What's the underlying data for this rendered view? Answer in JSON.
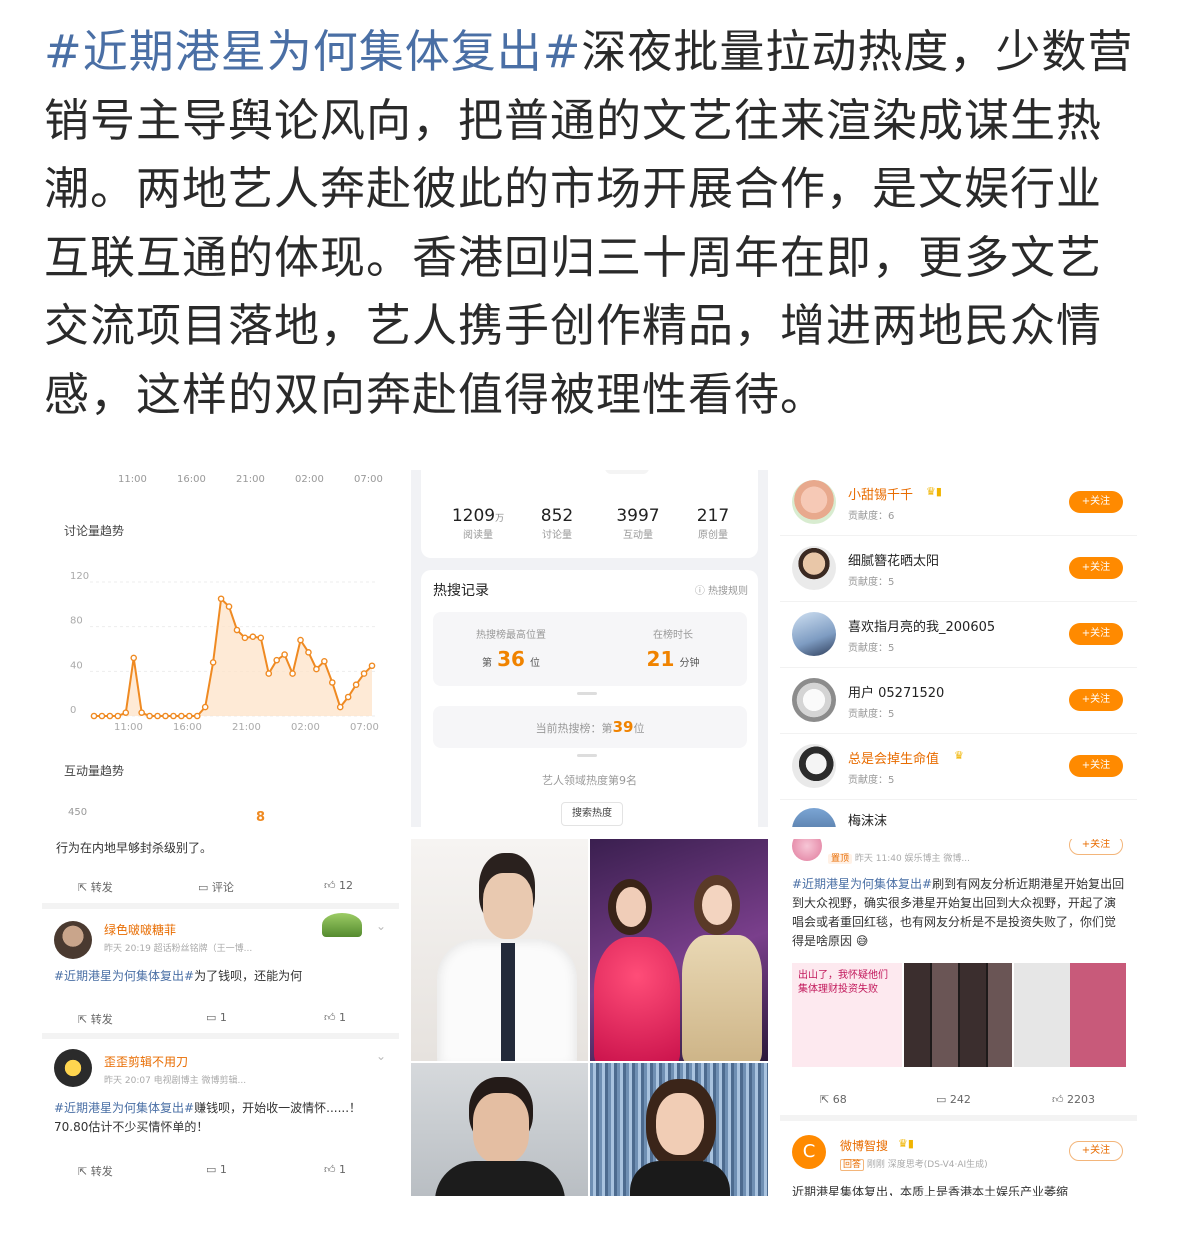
{
  "post": {
    "hashtag": "#近期港星为何集体复出#",
    "body": "深夜批量拉动热度，少数营销号主导舆论风向，把普通的文艺往来渲染成谋生热潮。两地艺人奔赴彼此的市场开展合作，是文娱行业互联互通的体现。香港回归三十周年在即，更多文艺交流项目落地，艺人携手创作精品，增进两地民众情感，这样的双向奔赴值得被理性看待。"
  },
  "trend_panel": {
    "top_ticks": [
      "11:00",
      "16:00",
      "21:00",
      "02:00",
      "07:00"
    ],
    "discussion_title": "讨论量趋势",
    "interaction_title": "互动量趋势",
    "interaction_tick": "450",
    "partial_marker": "8",
    "colors": {
      "line": "#ef8a22",
      "fill": "#fde3c8"
    }
  },
  "chart_data": {
    "type": "area",
    "title": "讨论量趋势",
    "x_ticks": [
      "11:00",
      "16:00",
      "21:00",
      "02:00",
      "07:00"
    ],
    "y_ticks": [
      0,
      40,
      80,
      120
    ],
    "ylim": [
      0,
      120
    ],
    "values": [
      0,
      0,
      0,
      0,
      3,
      52,
      3,
      0,
      0,
      0,
      0,
      0,
      0,
      0,
      8,
      48,
      105,
      98,
      77,
      70,
      71,
      70,
      38,
      50,
      55,
      38,
      68,
      57,
      42,
      49,
      30,
      8,
      17,
      28,
      38,
      45
    ],
    "grid": true
  },
  "stats_panel": {
    "overview": [
      {
        "value": "1209",
        "unit": "万",
        "label": "阅读量"
      },
      {
        "value": "852",
        "unit": "",
        "label": "讨论量"
      },
      {
        "value": "3997",
        "unit": "",
        "label": "互动量"
      },
      {
        "value": "217",
        "unit": "",
        "label": "原创量"
      }
    ],
    "hot_title": "热搜记录",
    "hot_rule": "热搜规则",
    "best_label": "热搜榜最高位置",
    "best_prefix": "第",
    "best_value": "36",
    "best_suffix": "位",
    "duration_label": "在榜时长",
    "duration_value": "21",
    "duration_unit": "分钟",
    "current_label": "当前热搜榜：第",
    "current_value": "39",
    "current_suffix": "位",
    "domain_rank": "艺人领域热度第9名",
    "search_heat": "搜索热度"
  },
  "contributors": {
    "follow_label": "+关注",
    "users": [
      {
        "name": "小甜锡千千",
        "contrib": "贡献度：6",
        "orange": true
      },
      {
        "name": "细腻簪花晒太阳",
        "contrib": "贡献度：5",
        "orange": false
      },
      {
        "name": "喜欢指月亮的我_200605",
        "contrib": "贡献度：5",
        "orange": false
      },
      {
        "name": "用户 05271520",
        "contrib": "贡献度：5",
        "orange": false
      },
      {
        "name": "总是会掉生命值",
        "contrib": "贡献度：5",
        "orange": true
      },
      {
        "name": "梅沫沫",
        "contrib": "",
        "orange": false
      }
    ]
  },
  "comments_panel": {
    "top_text": "行为在内地早够封杀级别了。",
    "bar1": {
      "repost": "转发",
      "comment": "评论",
      "like": "12"
    },
    "c1": {
      "name": "绿色啵啵糖菲",
      "meta": "昨天 20:19  超话粉丝铭牌（王一博...",
      "tag": "#近期港星为何集体复出#",
      "text": "为了钱呗，还能为何"
    },
    "bar2": {
      "repost": "转发",
      "comment": "1",
      "like": "1"
    },
    "c2": {
      "name": "歪歪剪辑不用刀",
      "meta": "昨天 20:07  电视剧博主  微博剪辑...",
      "tag": "#近期港星为何集体复出#",
      "text": "赚钱呗，开始收一波情怀......！70.80估计不少买情怀单的！"
    },
    "bar3": {
      "repost": "转发",
      "comment": "1",
      "like": "1"
    }
  },
  "repost_panel": {
    "meta": "昨天 11:40  娱乐博主  微博...",
    "badge": "置顶",
    "follow": "+关注",
    "tag": "#近期港星为何集体复出#",
    "text": "刷到有网友分析近期港星开始复出回到大众视野，确实很多港星开始复出回到大众视野，开起了演唱会或者重回红毯，也有网友分析是不是投资失败了，你们觉得是啥原因",
    "note": "出山了，我怀疑他们集体理财投资失败",
    "stats": {
      "repost": "68",
      "comment": "242",
      "like": "2203"
    },
    "bot_name": "微博智搜",
    "bot_meta": "刚刚  深度思考(DS-V4·AI生成)",
    "bot_badge": "回答",
    "bot_text": "近期港星集体复出，本质上是香港本土娱乐产业萎缩"
  }
}
